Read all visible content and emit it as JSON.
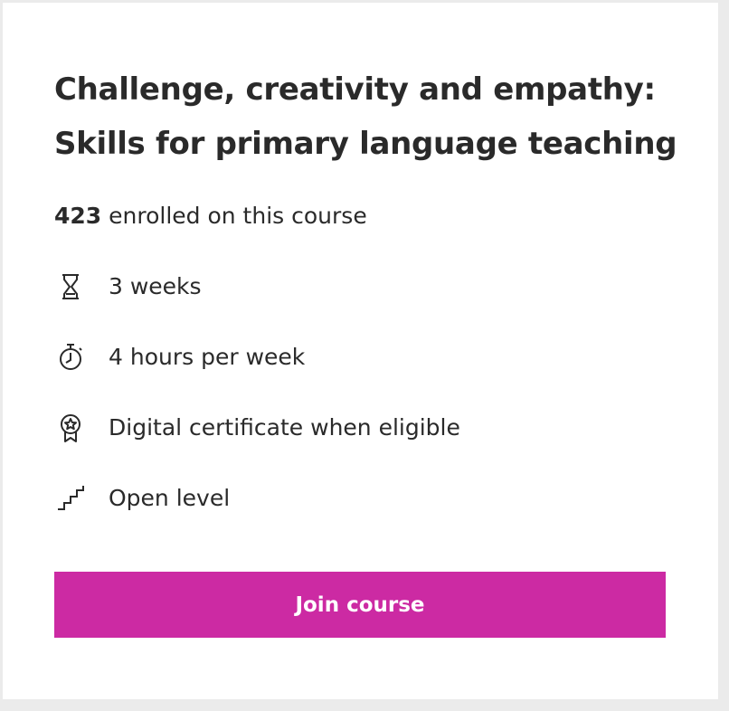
{
  "course": {
    "title_line1": "Challenge, creativity and empathy:",
    "title_line2": "Skills for primary language teaching",
    "enrolled_count": "423",
    "enrolled_text": " enrolled on this course",
    "features": [
      {
        "icon": "hourglass-icon",
        "label": "3 weeks"
      },
      {
        "icon": "stopwatch-icon",
        "label": "4 hours per week"
      },
      {
        "icon": "certificate-icon",
        "label": "Digital certificate when eligible"
      },
      {
        "icon": "stairs-icon",
        "label": "Open level"
      }
    ],
    "join_label": "Join course"
  },
  "colors": {
    "accent": "#cc2aa3",
    "text": "#2a2a2a",
    "background": "#ebebeb",
    "card": "#ffffff"
  }
}
